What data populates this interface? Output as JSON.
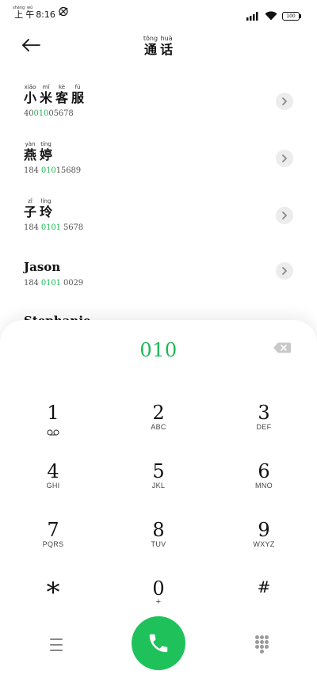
{
  "status_bar": {
    "period_chars": [
      {
        "pinyin": "shàng",
        "char": "上"
      },
      {
        "pinyin": "wǔ",
        "char": "午"
      }
    ],
    "time": "8:16",
    "battery": "100"
  },
  "header": {
    "title_chars": [
      {
        "pinyin": "tōng",
        "char": "通"
      },
      {
        "pinyin": "huà",
        "char": "话"
      }
    ]
  },
  "contacts": [
    {
      "name_chars": [
        {
          "pinyin": "xiǎo",
          "char": "小"
        },
        {
          "pinyin": "mǐ",
          "char": "米"
        },
        {
          "pinyin": "kè",
          "char": "客"
        },
        {
          "pinyin": "fú",
          "char": "服"
        }
      ],
      "number_pre": "40",
      "number_match": "010",
      "number_post": "05678"
    },
    {
      "name_chars": [
        {
          "pinyin": "yàn",
          "char": "燕"
        },
        {
          "pinyin": "tíng",
          "char": "婷"
        }
      ],
      "number_pre": "184 ",
      "number_match": "010",
      "number_post": "15689"
    },
    {
      "name_chars": [
        {
          "pinyin": "zǐ",
          "char": "子"
        },
        {
          "pinyin": "líng",
          "char": "玲"
        }
      ],
      "number_pre": "184 ",
      "number_match": "0101",
      "number_post": " 5678"
    },
    {
      "name": "Jason",
      "number_pre": "184 ",
      "number_match": "0101",
      "number_post": " 0029"
    }
  ],
  "partial_contact_name": "Stephanie",
  "dialpad": {
    "display": "010",
    "keys": [
      {
        "digit": "1",
        "letters": "voicemail-icon"
      },
      {
        "digit": "2",
        "letters": "ABC"
      },
      {
        "digit": "3",
        "letters": "DEF"
      },
      {
        "digit": "4",
        "letters": "GHI"
      },
      {
        "digit": "5",
        "letters": "JKL"
      },
      {
        "digit": "6",
        "letters": "MNO"
      },
      {
        "digit": "7",
        "letters": "PQRS"
      },
      {
        "digit": "8",
        "letters": "TUV"
      },
      {
        "digit": "9",
        "letters": "WXYZ"
      },
      {
        "digit": "*",
        "letters": ""
      },
      {
        "digit": "0",
        "letters": "+"
      },
      {
        "digit": "#",
        "letters": ""
      }
    ]
  },
  "colors": {
    "match_highlight": "#1db954",
    "call_button": "#1fc25a"
  }
}
